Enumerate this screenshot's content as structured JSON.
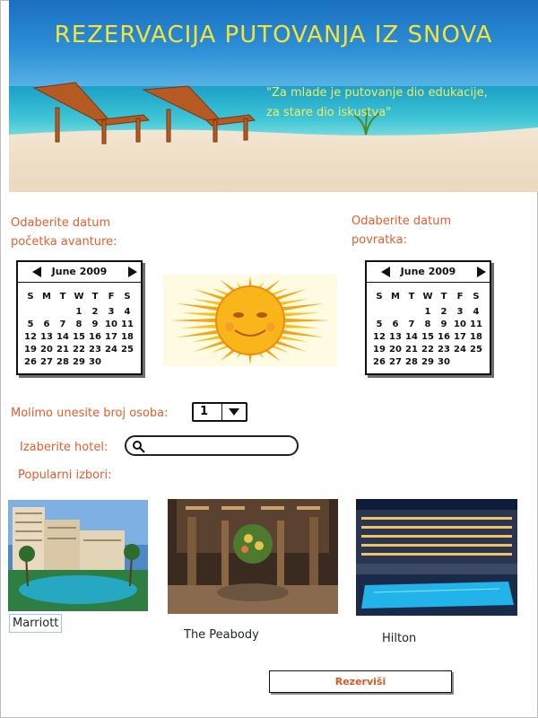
{
  "banner": {
    "title": "REZERVACIJA PUTOVANJA IZ SNOVA",
    "quote_line1": "\"Za mlade je putovanje dio edukacije,",
    "quote_line2": "za stare dio iskustva\""
  },
  "start_date": {
    "label_line1": "Odaberite datum",
    "label_line2": "početka avanture:",
    "month": "June 2009"
  },
  "return_date": {
    "label_line1": "Odaberite datum",
    "label_line2": "povratka:",
    "month": "June 2009"
  },
  "calendar": {
    "weekdays": [
      "S",
      "M",
      "T",
      "W",
      "T",
      "F",
      "S"
    ],
    "weeks": [
      [
        "",
        "",
        "",
        "",
        1,
        2,
        3,
        4
      ],
      [
        5,
        6,
        7,
        8,
        9,
        10,
        11
      ],
      [
        12,
        13,
        14,
        15,
        16,
        17,
        18
      ],
      [
        19,
        20,
        21,
        22,
        23,
        24,
        25
      ],
      [
        26,
        27,
        28,
        29,
        30,
        "",
        ""
      ]
    ]
  },
  "persons": {
    "label": "Molimo unesite broj osoba:",
    "value": "1"
  },
  "hotel": {
    "label": "Izaberite hotel:",
    "placeholder": ""
  },
  "popular": {
    "label": "Popularni izbori:",
    "hotels": [
      "Marriott",
      "The Peabody",
      "Hilton"
    ]
  },
  "reserve_button": "Rezerviši",
  "colors": {
    "accent": "#ec5b2a",
    "title": "#f5e23a"
  }
}
